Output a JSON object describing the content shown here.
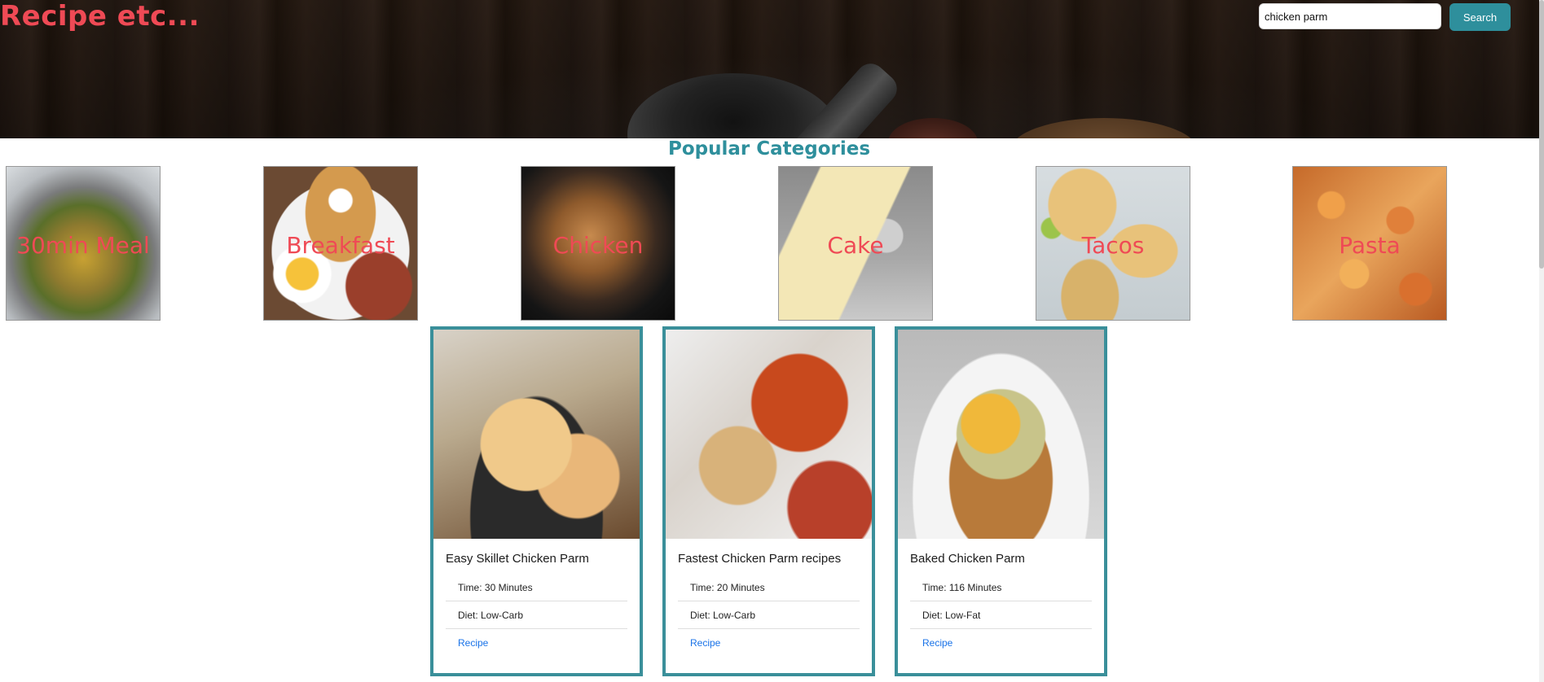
{
  "header": {
    "brand": "Recipe etc...",
    "search_value": "chicken parm",
    "search_button": "Search"
  },
  "categories": {
    "title": "Popular Categories",
    "items": [
      {
        "label": "30min Meal"
      },
      {
        "label": "Breakfast"
      },
      {
        "label": "Chicken"
      },
      {
        "label": "Cake"
      },
      {
        "label": "Tacos"
      },
      {
        "label": "Pasta"
      }
    ]
  },
  "recipes": [
    {
      "title": "Easy Skillet Chicken Parm",
      "time": "Time: 30 Minutes",
      "diet": "Diet: Low-Carb",
      "link": "Recipe"
    },
    {
      "title": "Fastest Chicken Parm recipes",
      "time": "Time: 20 Minutes",
      "diet": "Diet: Low-Carb",
      "link": "Recipe"
    },
    {
      "title": "Baked Chicken Parm",
      "time": "Time: 116 Minutes",
      "diet": "Diet: Low-Fat",
      "link": "Recipe"
    }
  ],
  "colors": {
    "brand": "#ef4a55",
    "accent": "#2e8f9c",
    "card_border": "#3a8f9a",
    "link": "#1a73e8"
  }
}
